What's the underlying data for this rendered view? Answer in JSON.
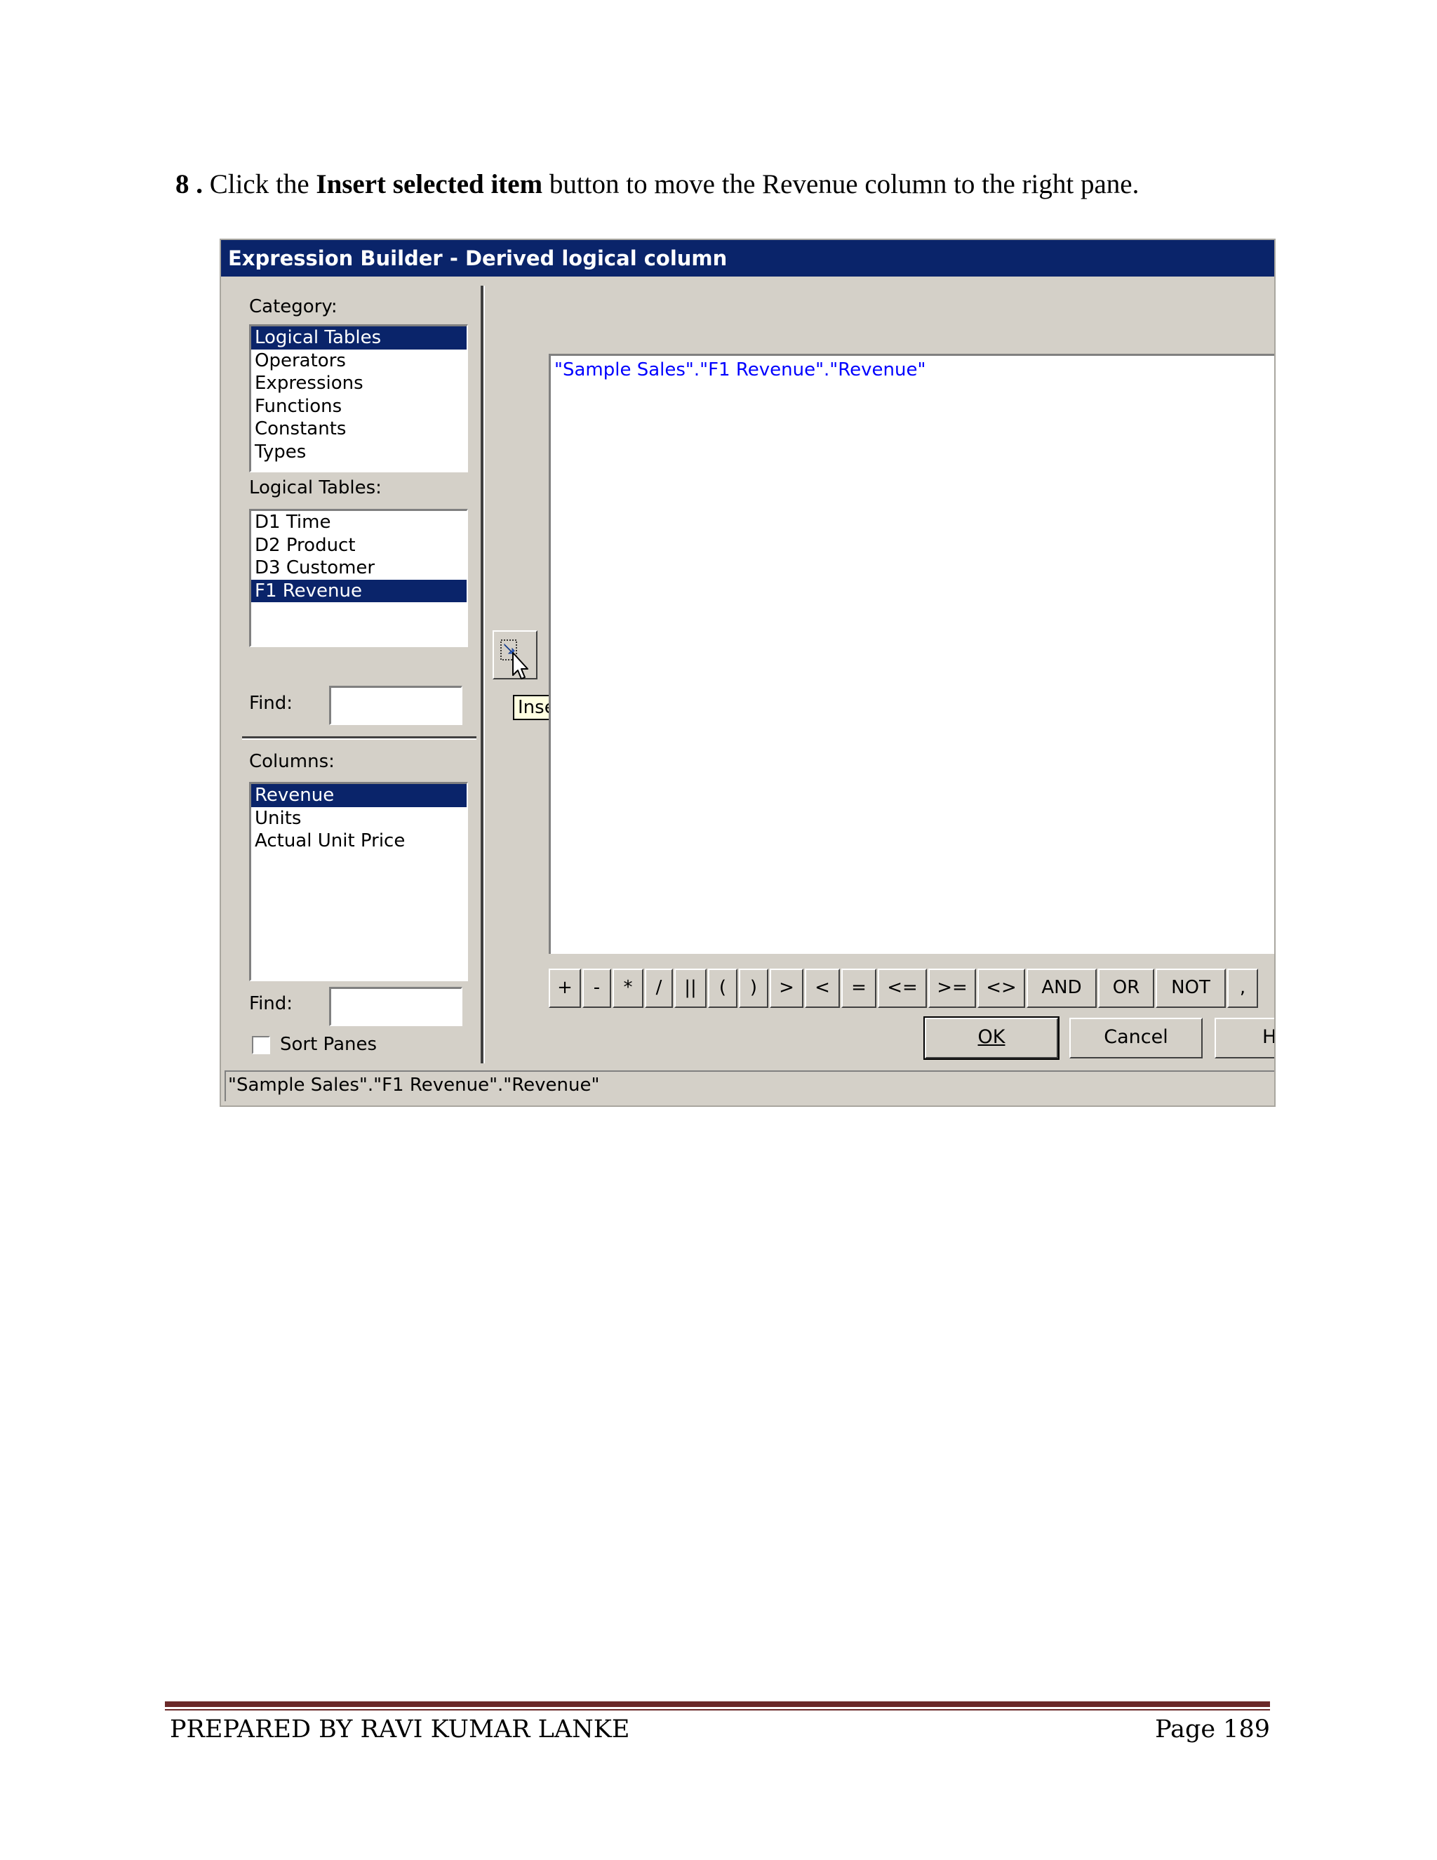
{
  "instruction": {
    "step": "8 .",
    "before": "Click the",
    "bold": "Insert selected item",
    "after": "button to move the Revenue column to the right pane."
  },
  "dialog": {
    "title": "Expression Builder - Derived logical column",
    "category_label": "Category:",
    "categories": [
      "Logical Tables",
      "Operators",
      "Expressions",
      "Functions",
      "Constants",
      "Types"
    ],
    "selected_category": "Logical Tables",
    "logical_tables_label": "Logical Tables:",
    "logical_tables": [
      "D1 Time",
      "D2 Product",
      "D3 Customer",
      "F1 Revenue"
    ],
    "selected_table": "F1 Revenue",
    "find_label": "Find:",
    "columns_label": "Columns:",
    "columns": [
      "Revenue",
      "Units",
      "Actual Unit Price"
    ],
    "selected_column": "Revenue",
    "find2_label": "Find:",
    "sort_panes_label": "Sort Panes",
    "sort_panes_checked": false,
    "tooltip": "Insert selected item",
    "expression": "\"Sample Sales\".\"F1 Revenue\".\"Revenue\"",
    "operators": [
      "+",
      "-",
      "*",
      "/",
      "||",
      "(",
      ")",
      ">",
      "<",
      "=",
      "<=",
      ">=",
      "<>",
      "AND",
      "OR",
      "NOT",
      ","
    ],
    "ok_label": "OK",
    "cancel_label": "Cancel",
    "help_label": "H",
    "status_text": "\"Sample Sales\".\"F1 Revenue\".\"Revenue\""
  },
  "footer": {
    "left": "PREPARED BY RAVI KUMAR LANKE",
    "right": "Page 189"
  }
}
